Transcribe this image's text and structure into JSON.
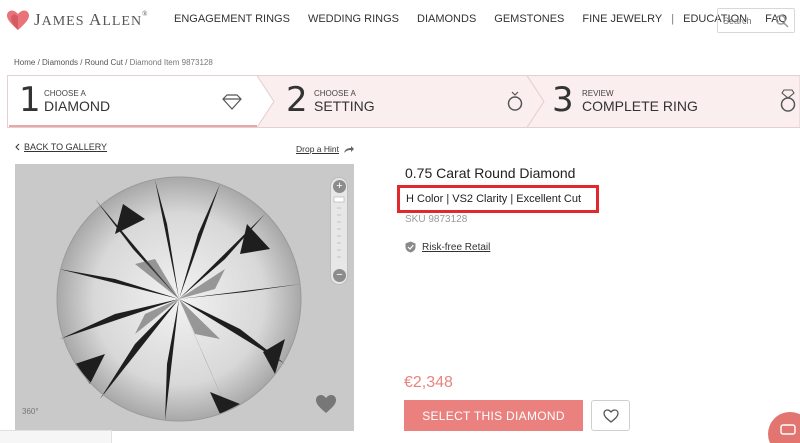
{
  "header": {
    "logo_text_first": "J",
    "logo_text_rest": "AMES ",
    "logo_text_second": "A",
    "logo_text_rest2": "LLEN",
    "logo_reg": "®",
    "nav": [
      "ENGAGEMENT RINGS",
      "WEDDING RINGS",
      "DIAMONDS",
      "GEMSTONES",
      "FINE JEWELRY",
      "|",
      "EDUCATION",
      "FAQ"
    ],
    "search_placeholder": "Search"
  },
  "breadcrumb": {
    "items": [
      "Home",
      "Diamonds",
      "Round Cut"
    ],
    "separator": " / ",
    "current": "Diamond Item 9873128"
  },
  "stepper": {
    "steps": [
      {
        "num": "1",
        "small": "CHOOSE A",
        "big": "DIAMOND",
        "icon": "diamond-icon"
      },
      {
        "num": "2",
        "small": "CHOOSE A",
        "big": "SETTING",
        "icon": "ring-icon"
      },
      {
        "num": "3",
        "small": "REVIEW",
        "big": "COMPLETE RING",
        "icon": "ring-complete-icon"
      }
    ]
  },
  "links": {
    "back": "BACK TO GALLERY",
    "hint": "Drop a Hint"
  },
  "viewer": {
    "badge": "360°"
  },
  "product": {
    "title": "0.75 Carat Round Diamond",
    "specs": "H Color  |  VS2 Clarity  |  Excellent Cut",
    "sku": "SKU 9873128",
    "risk_free": "Risk-free Retail",
    "price": "€2,348",
    "select_label": "SELECT THIS DIAMOND"
  },
  "colors": {
    "accent": "#ea817e",
    "highlight_box": "#e0282d",
    "step_bg": "#fbeeee"
  }
}
